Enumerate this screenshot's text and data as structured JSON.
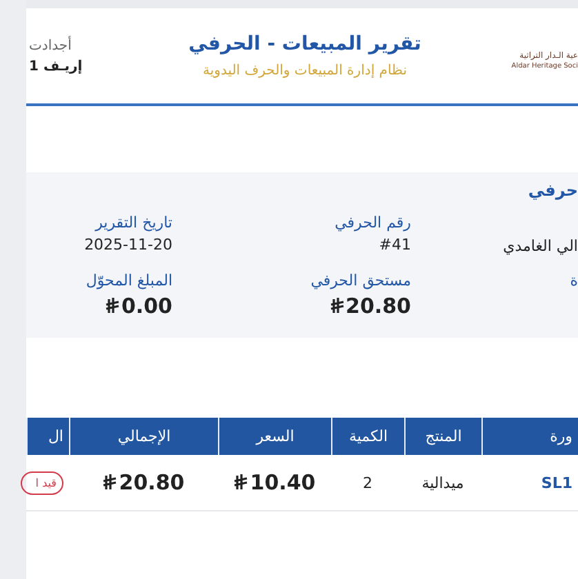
{
  "header": {
    "logo_arabic": "عية الـدار التراثية",
    "logo_english": "Aldar Heritage Soci",
    "title": "تقرير المبيعات - الحرفي",
    "subtitle": "نظام إدارة المبيعات والحرف اليدوية",
    "side_top": "أجدادت",
    "side_bottom": "إريـف 1"
  },
  "info": {
    "heading": "حرفي",
    "fields": [
      {
        "value": "الي الغامدي",
        "kind": "text"
      },
      {
        "label": "رقم الحرفي",
        "value": "#41",
        "kind": "text"
      },
      {
        "label": "تاريخ التقرير",
        "value": "2025-11-20",
        "kind": "text"
      },
      {
        "label": "ة",
        "kind": "text"
      },
      {
        "label": "مستحق الحرفي",
        "value": "20.80",
        "kind": "money"
      },
      {
        "label": "المبلغ المحوّل",
        "value": "0.00",
        "kind": "money"
      }
    ]
  },
  "table": {
    "columns": [
      "ورة",
      "المنتج",
      "الكمية",
      "السعر",
      "الإجمالي",
      "ال"
    ],
    "rows": [
      {
        "invoice": "SL1",
        "product": "ميدالية",
        "quantity": "2",
        "price": "10.40",
        "total": "20.80",
        "status": "قيد ا"
      }
    ]
  }
}
